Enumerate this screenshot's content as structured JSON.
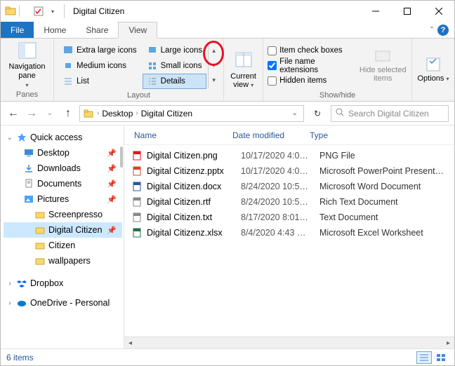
{
  "window": {
    "title": "Digital Citizen"
  },
  "tabs": {
    "file": "File",
    "home": "Home",
    "share": "Share",
    "view": "View"
  },
  "ribbon": {
    "panes": {
      "label": "Panes",
      "nav_pane": "Navigation pane"
    },
    "layout": {
      "label": "Layout",
      "extra_large": "Extra large icons",
      "large": "Large icons",
      "medium": "Medium icons",
      "small": "Small icons",
      "list": "List",
      "details": "Details"
    },
    "current_view": "Current view",
    "showhide": {
      "label": "Show/hide",
      "item_check": "Item check boxes",
      "file_ext": "File name extensions",
      "hidden": "Hidden items",
      "hide_selected": "Hide selected items"
    },
    "options": "Options"
  },
  "breadcrumbs": {
    "desktop": "Desktop",
    "current": "Digital Citizen"
  },
  "search": {
    "placeholder": "Search Digital Citizen"
  },
  "sidebar": {
    "quick_access": "Quick access",
    "desktop": "Desktop",
    "downloads": "Downloads",
    "documents": "Documents",
    "pictures": "Pictures",
    "screenpresso": "Screenpresso",
    "digital_citizen": "Digital Citizen",
    "citizen": "Citizen",
    "wallpapers": "wallpapers",
    "dropbox": "Dropbox",
    "onedrive": "OneDrive - Personal"
  },
  "columns": {
    "name": "Name",
    "date": "Date modified",
    "type": "Type"
  },
  "files": [
    {
      "icon": "png",
      "name": "Digital Citizen.png",
      "date": "10/17/2020 4:0…",
      "type": "PNG File"
    },
    {
      "icon": "pptx",
      "name": "Digital Citizenz.pptx",
      "date": "10/17/2020 4:0…",
      "type": "Microsoft PowerPoint Presenta…"
    },
    {
      "icon": "docx",
      "name": "Digital Citizen.docx",
      "date": "8/24/2020 10:5…",
      "type": "Microsoft Word Document"
    },
    {
      "icon": "rtf",
      "name": "Digital Citizen.rtf",
      "date": "8/24/2020 10:5…",
      "type": "Rich Text Document"
    },
    {
      "icon": "txt",
      "name": "Digital Citizen.txt",
      "date": "8/17/2020 8:01…",
      "type": "Text Document"
    },
    {
      "icon": "xlsx",
      "name": "Digital Citizenz.xlsx",
      "date": "8/4/2020 4:43 …",
      "type": "Microsoft Excel Worksheet"
    }
  ],
  "status": {
    "count": "6 items"
  }
}
